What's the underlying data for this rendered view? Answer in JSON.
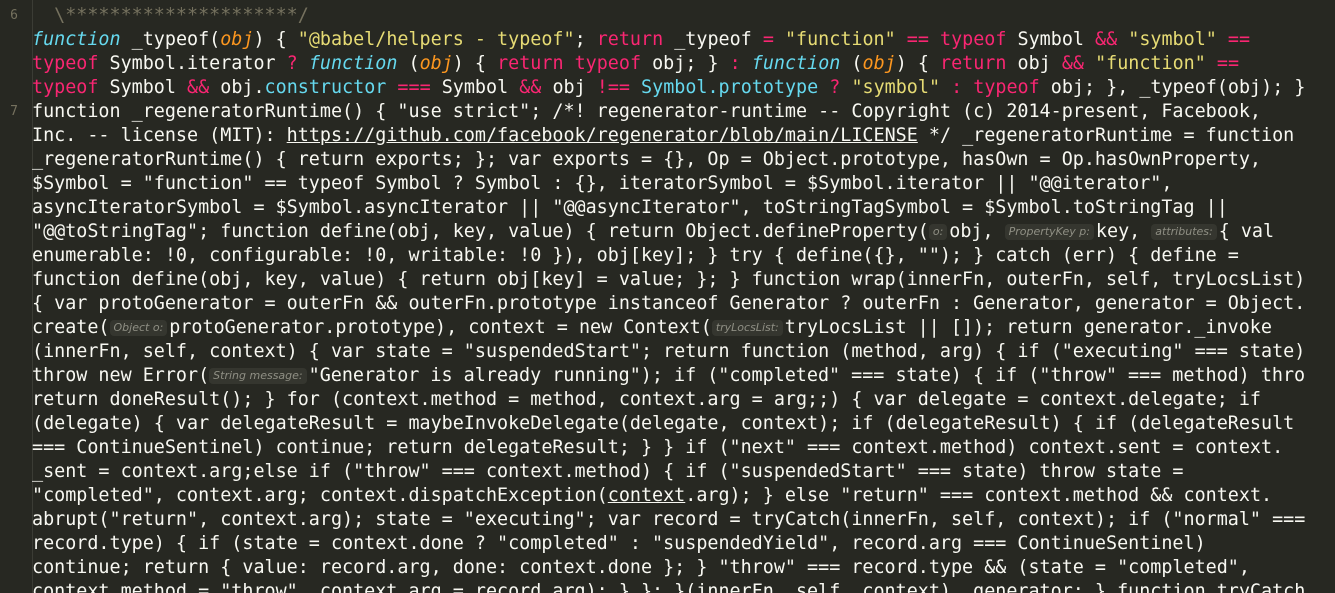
{
  "editor": {
    "line_numbers": [
      "6",
      "7"
    ],
    "lines": [
      [
        {
          "c": "cm",
          "t": "  \\*********************/"
        }
      ],
      [
        {
          "c": "fn-it",
          "t": "function"
        },
        {
          "c": "",
          "t": " _typeof("
        },
        {
          "c": "prm",
          "t": "obj"
        },
        {
          "c": "",
          "t": ") { "
        },
        {
          "c": "str",
          "t": "\"@babel/helpers - typeof\""
        },
        {
          "c": "",
          "t": "; "
        },
        {
          "c": "kw",
          "t": "return"
        },
        {
          "c": "",
          "t": " _typeof "
        },
        {
          "c": "op",
          "t": "="
        },
        {
          "c": "",
          "t": " "
        },
        {
          "c": "str",
          "t": "\"function\""
        },
        {
          "c": "",
          "t": " "
        },
        {
          "c": "op",
          "t": "=="
        },
        {
          "c": "",
          "t": " "
        },
        {
          "c": "kw",
          "t": "typeof"
        },
        {
          "c": "",
          "t": " Symbol "
        },
        {
          "c": "op",
          "t": "&&"
        },
        {
          "c": "",
          "t": " "
        },
        {
          "c": "str",
          "t": "\"symbol\""
        },
        {
          "c": "",
          "t": " "
        },
        {
          "c": "op",
          "t": "=="
        }
      ],
      [
        {
          "c": "kw",
          "t": "typeof"
        },
        {
          "c": "",
          "t": " Symbol.iterator "
        },
        {
          "c": "op",
          "t": "?"
        },
        {
          "c": "",
          "t": " "
        },
        {
          "c": "fn-it",
          "t": "function"
        },
        {
          "c": "",
          "t": " ("
        },
        {
          "c": "prm",
          "t": "obj"
        },
        {
          "c": "",
          "t": ") { "
        },
        {
          "c": "kw",
          "t": "return"
        },
        {
          "c": "",
          "t": " "
        },
        {
          "c": "kw",
          "t": "typeof"
        },
        {
          "c": "",
          "t": " obj; } "
        },
        {
          "c": "op",
          "t": ":"
        },
        {
          "c": "",
          "t": " "
        },
        {
          "c": "fn-it",
          "t": "function"
        },
        {
          "c": "",
          "t": " ("
        },
        {
          "c": "prm",
          "t": "obj"
        },
        {
          "c": "",
          "t": ") { "
        },
        {
          "c": "kw",
          "t": "return"
        },
        {
          "c": "",
          "t": " obj "
        },
        {
          "c": "op",
          "t": "&&"
        },
        {
          "c": "",
          "t": " "
        },
        {
          "c": "str",
          "t": "\"function\""
        },
        {
          "c": "",
          "t": " "
        },
        {
          "c": "op",
          "t": "=="
        }
      ],
      [
        {
          "c": "kw",
          "t": "typeof"
        },
        {
          "c": "",
          "t": " Symbol "
        },
        {
          "c": "op",
          "t": "&&"
        },
        {
          "c": "",
          "t": " obj."
        },
        {
          "c": "prop",
          "t": "constructor"
        },
        {
          "c": "",
          "t": " "
        },
        {
          "c": "op",
          "t": "==="
        },
        {
          "c": "",
          "t": " Symbol "
        },
        {
          "c": "op",
          "t": "&&"
        },
        {
          "c": "",
          "t": " obj "
        },
        {
          "c": "op",
          "t": "!=="
        },
        {
          "c": "",
          "t": " "
        },
        {
          "c": "prop",
          "t": "Symbol.prototype"
        },
        {
          "c": "",
          "t": " "
        },
        {
          "c": "op",
          "t": "?"
        },
        {
          "c": "",
          "t": " "
        },
        {
          "c": "str",
          "t": "\"symbol\""
        },
        {
          "c": "",
          "t": " "
        },
        {
          "c": "op",
          "t": ":"
        },
        {
          "c": "",
          "t": " "
        },
        {
          "c": "kw",
          "t": "typeof"
        },
        {
          "c": "",
          "t": " obj; }, _typeof(obj); }"
        }
      ],
      [
        {
          "c": "",
          "t": "function _regeneratorRuntime() { \"use strict\"; /*! regenerator-runtime -- Copyright (c) 2014-present, Facebook,"
        }
      ],
      [
        {
          "c": "",
          "t": "Inc. -- license (MIT): "
        },
        {
          "c": "link",
          "t": "https://github.com/facebook/regenerator/blob/main/LICENSE"
        },
        {
          "c": "",
          "t": " */ _regeneratorRuntime = function"
        }
      ],
      [
        {
          "c": "",
          "t": "_regeneratorRuntime() { return exports; }; var exports = {}, Op = Object.prototype, hasOwn = Op.hasOwnProperty,"
        }
      ],
      [
        {
          "c": "",
          "t": "$Symbol = \"function\" == typeof Symbol ? Symbol : {}, iteratorSymbol = $Symbol.iterator || \"@@iterator\","
        }
      ],
      [
        {
          "c": "",
          "t": "asyncIteratorSymbol = $Symbol.asyncIterator || \"@@asyncIterator\", toStringTagSymbol = $Symbol.toStringTag ||"
        }
      ],
      [
        {
          "c": "",
          "t": "\"@@toStringTag\"; function define(obj, key, value) { return Object.defineProperty("
        },
        {
          "c": "hint",
          "t": "o:"
        },
        {
          "c": "",
          "t": "obj, "
        },
        {
          "c": "hint",
          "t": "PropertyKey p:"
        },
        {
          "c": "",
          "t": "key, "
        },
        {
          "c": "hint",
          "t": "attributes:"
        },
        {
          "c": "",
          "t": "{ val"
        }
      ],
      [
        {
          "c": "",
          "t": "enumerable: !0, configurable: !0, writable: !0 }), obj[key]; } try { define({}, \"\"); } catch (err) { define ="
        }
      ],
      [
        {
          "c": "",
          "t": "function define(obj, key, value) { return obj[key] = value; }; } function wrap(innerFn, outerFn, self, tryLocsList)"
        }
      ],
      [
        {
          "c": "",
          "t": "{ var protoGenerator = outerFn && outerFn.prototype instanceof Generator ? outerFn : Generator, generator = Object."
        }
      ],
      [
        {
          "c": "",
          "t": "create("
        },
        {
          "c": "hint",
          "t": "Object o:"
        },
        {
          "c": "",
          "t": "protoGenerator.prototype), context = new Context("
        },
        {
          "c": "hint",
          "t": "tryLocsList:"
        },
        {
          "c": "",
          "t": "tryLocsList || []); return generator._invoke"
        }
      ],
      [
        {
          "c": "",
          "t": "(innerFn, self, context) { var state = \"suspendedStart\"; return function (method, arg) { if (\"executing\" === state)"
        }
      ],
      [
        {
          "c": "",
          "t": "throw new Error("
        },
        {
          "c": "hint",
          "t": "String message:"
        },
        {
          "c": "",
          "t": "\"Generator is already running\"); if (\"completed\" === state) { if (\"throw\" === method) thro"
        }
      ],
      [
        {
          "c": "",
          "t": "return doneResult(); } for (context.method = method, context.arg = arg;;) { var delegate = context.delegate; if"
        }
      ],
      [
        {
          "c": "",
          "t": "(delegate) { var delegateResult = maybeInvokeDelegate(delegate, context); if (delegateResult) { if (delegateResult"
        }
      ],
      [
        {
          "c": "",
          "t": "=== ContinueSentinel) continue; return delegateResult; } } if (\"next\" === context.method) context.sent = context."
        }
      ],
      [
        {
          "c": "",
          "t": "_sent = context.arg;else if (\"throw\" === context.method) { if (\"suspendedStart\" === state) throw state ="
        }
      ],
      [
        {
          "c": "",
          "t": "\"completed\", context.arg; context.dispatchException("
        },
        {
          "c": "link",
          "t": "context"
        },
        {
          "c": "",
          "t": ".arg); } else \"return\" === context.method && context."
        }
      ],
      [
        {
          "c": "",
          "t": "abrupt(\"return\", context.arg); state = \"executing\"; var record = tryCatch(innerFn, self, context); if (\"normal\" ==="
        }
      ],
      [
        {
          "c": "",
          "t": "record.type) { if (state = context.done ? \"completed\" : \"suspendedYield\", record.arg === ContinueSentinel)"
        }
      ],
      [
        {
          "c": "",
          "t": "continue; return { value: record.arg, done: context.done }; } \"throw\" === record.type && (state = \"completed\","
        }
      ],
      [
        {
          "c": "",
          "t": "context.method = \"throw\", context.arg = record.arg); } }; }(innerFn, self, context), generator; } function tryCatch"
        }
      ]
    ]
  }
}
